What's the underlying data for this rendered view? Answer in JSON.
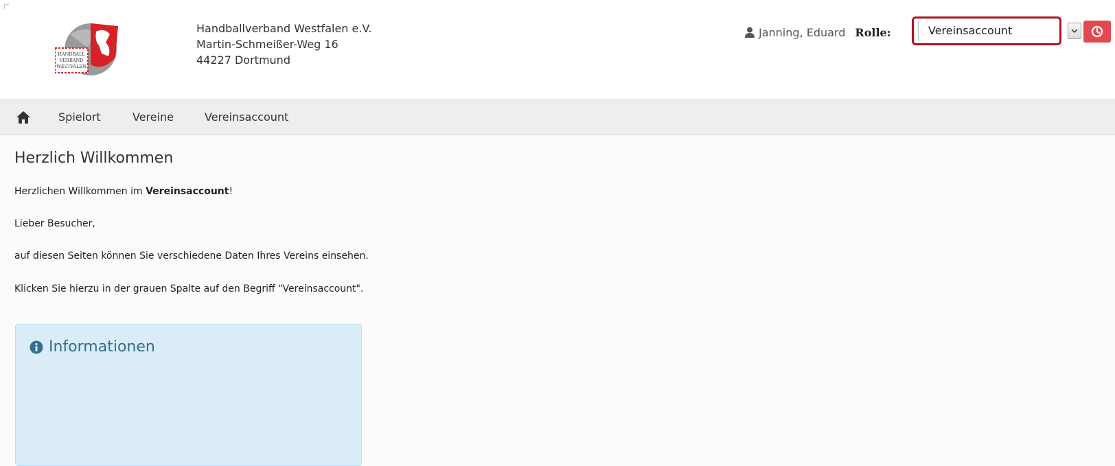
{
  "org": {
    "name": "Handballverband Westfalen e.V.",
    "street": "Martin-Schmeißer-Weg 16",
    "city": "44227 Dortmund",
    "logo_text": [
      "HANDBALL",
      "VERBAND",
      "WESTFALEN"
    ]
  },
  "user": {
    "name": "Janning, Eduard",
    "role_label": "Rolle:",
    "role_value": "Vereinsaccount"
  },
  "nav": {
    "items": [
      "Spielort",
      "Vereine",
      "Vereinsaccount"
    ]
  },
  "main": {
    "title": "Herzlich Willkommen",
    "welcome_prefix": "Herzlichen Willkommen im ",
    "welcome_bold": "Vereinsaccount",
    "welcome_suffix": "!",
    "greeting": "Lieber Besucher,",
    "line1": "auf diesen Seiten können Sie verschiedene Daten Ihres Vereins einsehen.",
    "line2": "Klicken Sie hierzu in der grauen Spalte auf den Begriff \"Vereinsaccount\"."
  },
  "info": {
    "title": "Informationen"
  },
  "colors": {
    "accent_red": "#e5474f",
    "highlight_border": "#b3121d",
    "info_bg": "#d9ecf7",
    "info_text": "#31708f",
    "nav_bg": "#eeeeee"
  }
}
